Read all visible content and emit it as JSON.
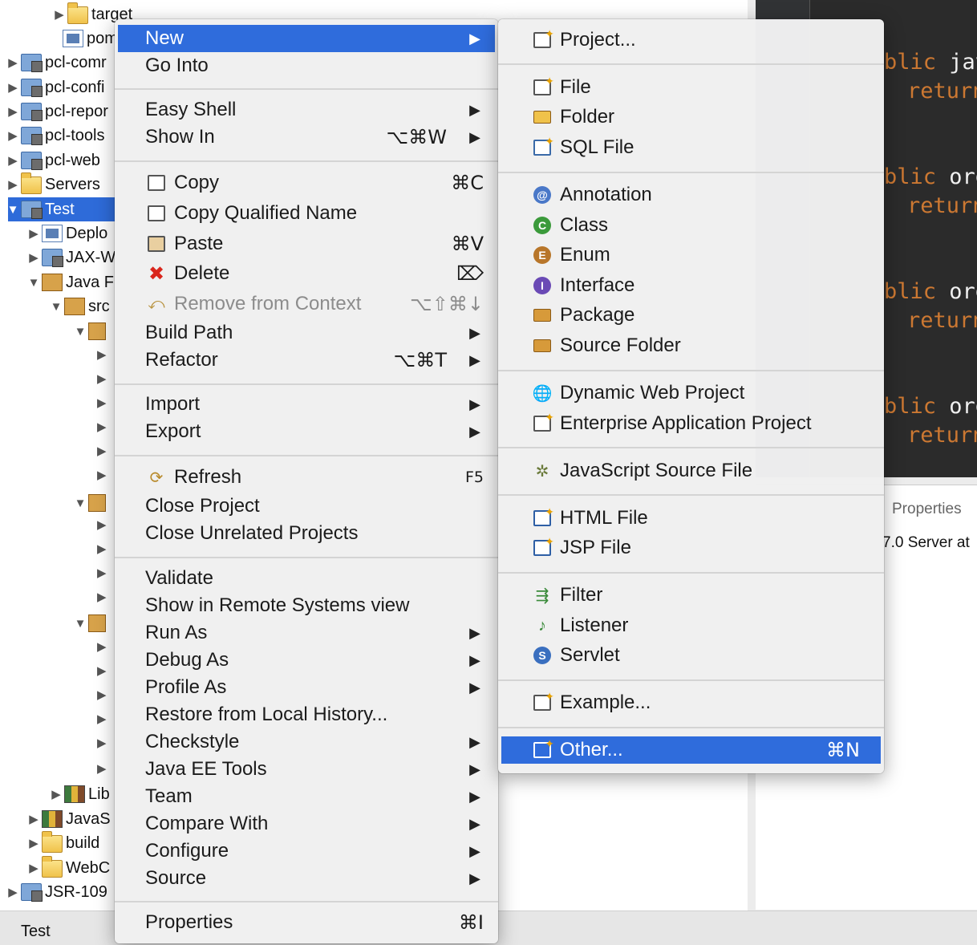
{
  "explorer": {
    "rows": [
      {
        "label": "target",
        "icon": "folder-icon"
      },
      {
        "label": "pom.x",
        "icon": "xml-file-icon"
      },
      {
        "label": "pcl-comr",
        "icon": "maven-project-icon"
      },
      {
        "label": "pcl-confi",
        "icon": "maven-project-icon"
      },
      {
        "label": "pcl-repor",
        "icon": "maven-project-icon"
      },
      {
        "label": "pcl-tools",
        "icon": "maven-project-icon"
      },
      {
        "label": "pcl-web",
        "icon": "maven-project-icon"
      },
      {
        "label": "Servers",
        "icon": "folder-icon"
      },
      {
        "label": "Test",
        "icon": "web-project-icon",
        "selected": true
      },
      {
        "label": "Deplo",
        "icon": "deployment-descriptor-icon"
      },
      {
        "label": "JAX-W",
        "icon": "jax-ws-icon"
      },
      {
        "label": "Java F",
        "icon": "java-resources-icon"
      },
      {
        "label": "src",
        "icon": "source-folder-icon"
      },
      {
        "label": "Lib",
        "icon": "library-icon"
      },
      {
        "label": "JavaS",
        "icon": "library-icon"
      },
      {
        "label": "build",
        "icon": "folder-icon"
      },
      {
        "label": "WebC",
        "icon": "folder-icon"
      },
      {
        "label": "JSR-109",
        "icon": "web-services-icon"
      }
    ]
  },
  "editor": {
    "lines": [
      {
        "kw": "blic",
        "rest": " jav"
      },
      {
        "kw": "return",
        "rest": ""
      },
      {
        "kw": "blic",
        "rest": " org"
      },
      {
        "kw": "return",
        "rest": ""
      },
      {
        "kw": "blic",
        "rest": " org"
      },
      {
        "kw": "return",
        "rest": ""
      },
      {
        "kw": "blic",
        "rest": " org"
      },
      {
        "kw": "return",
        "rest": ""
      }
    ]
  },
  "properties": {
    "tab_label": "Properties",
    "line": "7.0 Server at"
  },
  "status_bar": {
    "label": "Test"
  },
  "context_menu": {
    "items": [
      {
        "label": "New",
        "submenu": true,
        "highlighted": true
      },
      {
        "label": "Go Into"
      },
      {
        "separator": true
      },
      {
        "label": "Easy Shell",
        "submenu": true
      },
      {
        "label": "Show In",
        "shortcut": "⌥⌘W",
        "submenu": true
      },
      {
        "separator": true
      },
      {
        "label": "Copy",
        "shortcut": "⌘C",
        "icon": "copy-icon"
      },
      {
        "label": "Copy Qualified Name",
        "icon": "copy-qualified-name-icon"
      },
      {
        "label": "Paste",
        "shortcut": "⌘V",
        "icon": "paste-icon"
      },
      {
        "label": "Delete",
        "shortcut": "⌦",
        "icon": "delete-icon"
      },
      {
        "label": "Remove from Context",
        "shortcut": "⌥⇧⌘↓",
        "icon": "remove-context-icon",
        "disabled": true
      },
      {
        "label": "Build Path",
        "submenu": true
      },
      {
        "label": "Refactor",
        "shortcut": "⌥⌘T",
        "submenu": true
      },
      {
        "separator": true
      },
      {
        "label": "Import",
        "submenu": true
      },
      {
        "label": "Export",
        "submenu": true
      },
      {
        "separator": true
      },
      {
        "label": "Refresh",
        "shortcut": "F5",
        "icon": "refresh-icon"
      },
      {
        "label": "Close Project"
      },
      {
        "label": "Close Unrelated Projects"
      },
      {
        "separator": true
      },
      {
        "label": "Validate"
      },
      {
        "label": "Show in Remote Systems view"
      },
      {
        "label": "Run As",
        "submenu": true
      },
      {
        "label": "Debug As",
        "submenu": true
      },
      {
        "label": "Profile As",
        "submenu": true
      },
      {
        "label": "Restore from Local History..."
      },
      {
        "label": "Checkstyle",
        "submenu": true
      },
      {
        "label": "Java EE Tools",
        "submenu": true
      },
      {
        "label": "Team",
        "submenu": true
      },
      {
        "label": "Compare With",
        "submenu": true
      },
      {
        "label": "Configure",
        "submenu": true
      },
      {
        "label": "Source",
        "submenu": true
      },
      {
        "separator": true
      },
      {
        "label": "Properties",
        "shortcut": "⌘I"
      }
    ]
  },
  "new_submenu": {
    "items": [
      {
        "label": "Project...",
        "icon": "new-project-icon"
      },
      {
        "separator": true
      },
      {
        "label": "File",
        "icon": "new-file-icon"
      },
      {
        "label": "Folder",
        "icon": "new-folder-icon"
      },
      {
        "label": "SQL File",
        "icon": "sql-file-icon"
      },
      {
        "separator": true
      },
      {
        "label": "Annotation",
        "icon": "annotation-icon"
      },
      {
        "label": "Class",
        "icon": "class-icon"
      },
      {
        "label": "Enum",
        "icon": "enum-icon"
      },
      {
        "label": "Interface",
        "icon": "interface-icon"
      },
      {
        "label": "Package",
        "icon": "package-icon"
      },
      {
        "label": "Source Folder",
        "icon": "source-folder-icon"
      },
      {
        "separator": true
      },
      {
        "label": "Dynamic Web Project",
        "icon": "dynamic-web-project-icon"
      },
      {
        "label": "Enterprise Application Project",
        "icon": "enterprise-app-project-icon"
      },
      {
        "separator": true
      },
      {
        "label": "JavaScript Source File",
        "icon": "javascript-file-icon"
      },
      {
        "separator": true
      },
      {
        "label": "HTML File",
        "icon": "html-file-icon"
      },
      {
        "label": "JSP File",
        "icon": "jsp-file-icon"
      },
      {
        "separator": true
      },
      {
        "label": "Filter",
        "icon": "filter-icon"
      },
      {
        "label": "Listener",
        "icon": "listener-icon"
      },
      {
        "label": "Servlet",
        "icon": "servlet-icon"
      },
      {
        "separator": true
      },
      {
        "label": "Example...",
        "icon": "example-icon"
      },
      {
        "separator": true
      },
      {
        "label": "Other...",
        "icon": "other-wizard-icon",
        "shortcut": "⌘N",
        "highlighted": true
      }
    ]
  },
  "colors": {
    "highlight": "#2f6cdc",
    "selection": "#2e6bd9",
    "editor_bg": "#2b2b2b",
    "keyword": "#cc7832",
    "delete_red": "#d9261c"
  }
}
